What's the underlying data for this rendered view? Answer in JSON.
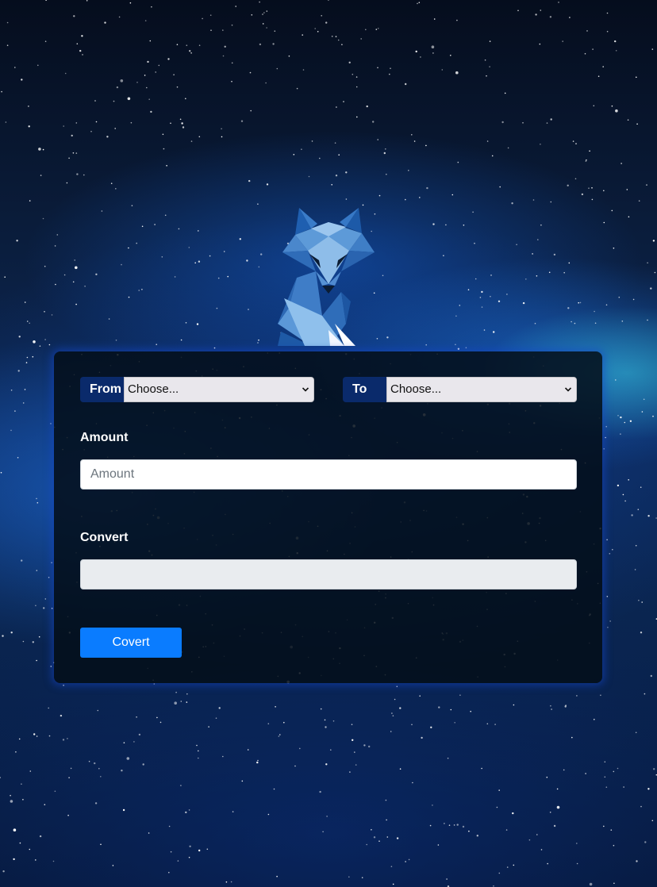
{
  "brand": {
    "logo_icon": "fox-logo-icon"
  },
  "form": {
    "from": {
      "label": "From",
      "selected": "Choose..."
    },
    "to": {
      "label": "To",
      "selected": "Choose..."
    },
    "amount": {
      "label": "Amount",
      "placeholder": "Amount",
      "value": ""
    },
    "convert": {
      "label": "Convert",
      "value": ""
    },
    "submit_label": "Covert"
  },
  "colors": {
    "card_bg": "#040e18",
    "addon_bg": "#0a2a6b",
    "button_bg": "#0a7cff",
    "select_bg": "#e9e7ec",
    "readonly_bg": "#e9ecef"
  }
}
